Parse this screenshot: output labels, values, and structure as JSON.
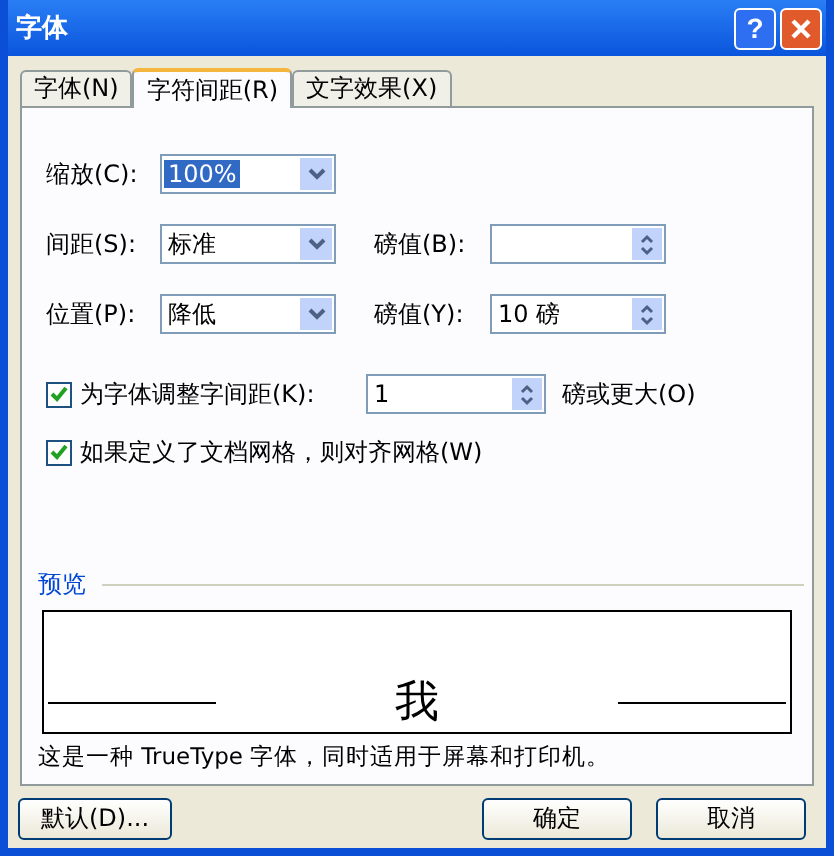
{
  "window": {
    "title": "字体",
    "help_button": "?"
  },
  "tabs": [
    {
      "label": "字体(N)",
      "selected": false
    },
    {
      "label": "字符间距(R)",
      "selected": true
    },
    {
      "label": "文字效果(X)",
      "selected": false
    }
  ],
  "scale": {
    "label": "缩放(C):",
    "value": "100%",
    "highlighted": true
  },
  "spacing": {
    "label": "间距(S):",
    "value": "标准",
    "points_label": "磅值(B):"
  },
  "position": {
    "label": "位置(P):",
    "value": "降低",
    "points_label": "磅值(Y):",
    "points_value": "10 磅"
  },
  "options": [
    {
      "label": "为字体调整字间距(K):",
      "checked": true,
      "value": "1",
      "suffix": "磅或更大(O)"
    },
    {
      "label": "如果定义了文档网格，则对齐网格(W)",
      "checked": true
    }
  ],
  "preview": {
    "label": "预览",
    "sample": "我",
    "description": "这是一种 TrueType 字体，同时适用于屏幕和打印机。"
  },
  "buttons": [
    {
      "label": "默认(D)..."
    },
    {
      "label": "确定"
    },
    {
      "label": "取消"
    }
  ]
}
